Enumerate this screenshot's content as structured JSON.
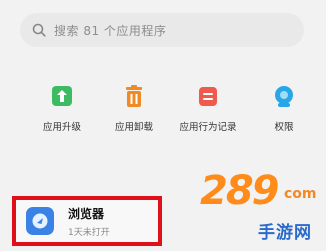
{
  "search": {
    "placeholder": "搜索 81 个应用程序",
    "icon": "search-icon"
  },
  "tools": [
    {
      "label": "应用升级",
      "icon": "upload-icon",
      "color": "#3dbb62"
    },
    {
      "label": "应用卸载",
      "icon": "trash-icon",
      "color": "#f08a24"
    },
    {
      "label": "应用行为记录",
      "icon": "record-icon",
      "color": "#ee5a4e"
    },
    {
      "label": "权限",
      "icon": "permission-icon",
      "color": "#27a6e8"
    }
  ],
  "app": {
    "name": "浏览器",
    "subtitle": "1天未打开",
    "icon": "browser-icon",
    "highlight_color": "#e0101a"
  },
  "watermark": {
    "number": "289",
    "domain": "com",
    "text": "手游网"
  }
}
